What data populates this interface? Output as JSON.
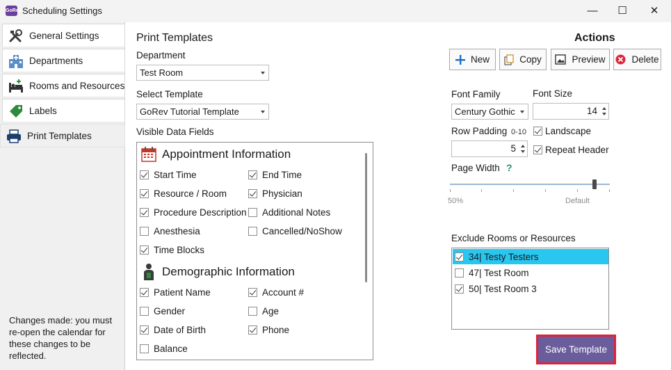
{
  "window": {
    "title": "Scheduling Settings",
    "icon_text": "GoRev",
    "controls": {
      "minimize": "—",
      "maximize": "☐",
      "close": "✕"
    }
  },
  "sidebar": {
    "items": [
      {
        "label": "General Settings",
        "icon": "tools-icon"
      },
      {
        "label": "Departments",
        "icon": "hospital-icon"
      },
      {
        "label": "Rooms and Resources",
        "icon": "bed-icon"
      },
      {
        "label": "Labels",
        "icon": "tag-icon"
      },
      {
        "label": "Print Templates",
        "icon": "printer-icon",
        "active": true
      }
    ],
    "note": "Changes made: you must re-open the calendar for these changes to be reflected."
  },
  "print_templates": {
    "title": "Print Templates",
    "department_label": "Department",
    "department_value": "Test Room",
    "select_template_label": "Select Template",
    "template_value": "GoRev Tutorial Template",
    "visible_fields_label": "Visible Data Fields",
    "appointment_section": "Appointment Information",
    "appointment_fields": [
      {
        "label": "Start Time",
        "checked": true
      },
      {
        "label": "End Time",
        "checked": true
      },
      {
        "label": "Resource / Room",
        "checked": true
      },
      {
        "label": "Physician",
        "checked": true
      },
      {
        "label": "Procedure Description",
        "checked": true
      },
      {
        "label": "Additional Notes",
        "checked": false
      },
      {
        "label": "Anesthesia",
        "checked": false
      },
      {
        "label": "Cancelled/NoShow",
        "checked": false
      },
      {
        "label": "Time Blocks",
        "checked": true
      }
    ],
    "demographic_section": "Demographic Information",
    "demographic_fields": [
      {
        "label": "Patient Name",
        "checked": true
      },
      {
        "label": "Account #",
        "checked": true
      },
      {
        "label": "Gender",
        "checked": false
      },
      {
        "label": "Age",
        "checked": false
      },
      {
        "label": "Date of Birth",
        "checked": true
      },
      {
        "label": "Phone",
        "checked": true
      },
      {
        "label": "Balance",
        "checked": false
      }
    ]
  },
  "actions": {
    "title": "Actions",
    "new_label": "New",
    "copy_label": "Copy",
    "preview_label": "Preview",
    "delete_label": "Delete",
    "font_family_label": "Font Family",
    "font_family_value": "Century Gothic",
    "font_size_label": "Font Size",
    "font_size_value": "14",
    "row_padding_label": "Row Padding",
    "row_padding_range": "0-10",
    "row_padding_value": "5",
    "landscape_label": "Landscape",
    "landscape_checked": true,
    "repeat_header_label": "Repeat Header",
    "repeat_header_checked": true,
    "page_width_label": "Page Width",
    "page_width_help": "?",
    "page_width_min_label": "50%",
    "page_width_default_label": "Default",
    "exclude_label": "Exclude Rooms or Resources",
    "exclude_items": [
      {
        "label": "34| Testy Testers",
        "checked": true,
        "selected": true
      },
      {
        "label": "47| Test Room",
        "checked": false,
        "selected": false
      },
      {
        "label": "50| Test Room 3",
        "checked": true,
        "selected": false
      }
    ],
    "save_label": "Save Template"
  },
  "colors": {
    "accent_selected": "#29c6f0",
    "save_button": "#6a5d9c",
    "save_outline": "#e0203c",
    "new_plus": "#1b6fc4",
    "delete_red": "#d9263a"
  }
}
